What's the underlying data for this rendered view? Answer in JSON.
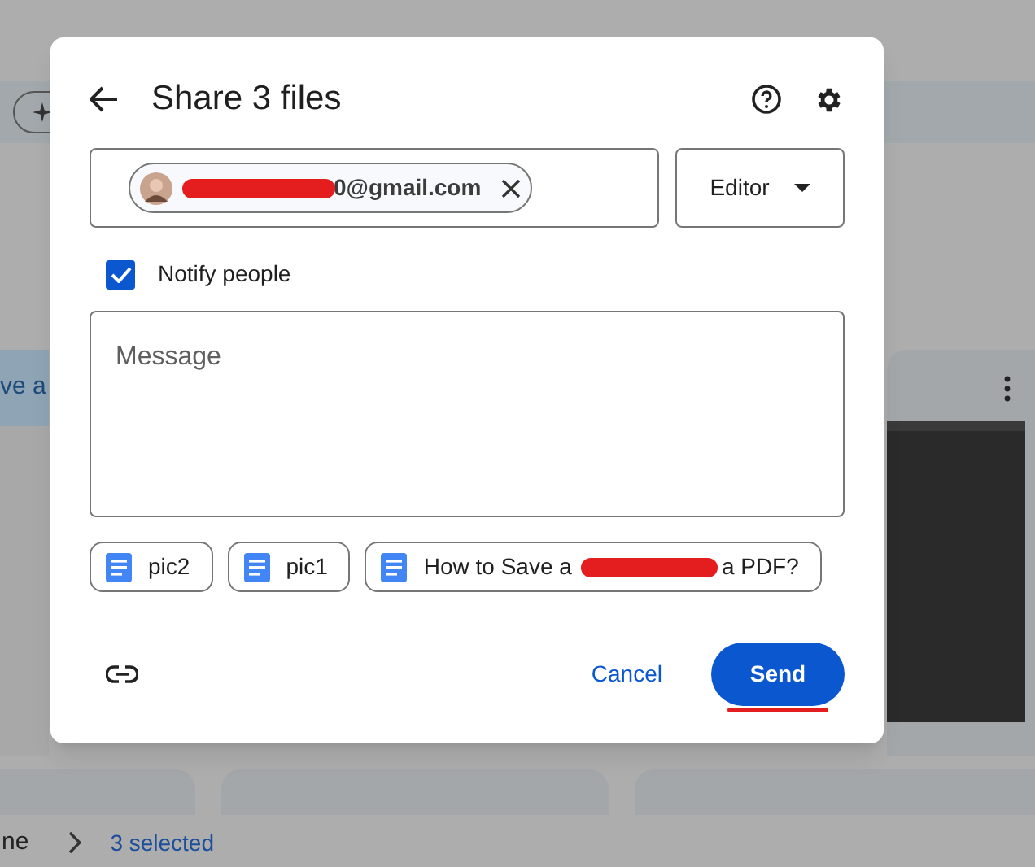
{
  "background": {
    "card_title": "ve a",
    "breadcrumb": {
      "parent": "ne",
      "current": "3 selected"
    }
  },
  "dialog": {
    "title": "Share 3 files",
    "recipient": {
      "email_visible": "0@gmail.com"
    },
    "role": "Editor",
    "notify": {
      "label": "Notify people",
      "checked": true
    },
    "message": {
      "placeholder": "Message"
    },
    "files": [
      {
        "name": "pic2"
      },
      {
        "name": "pic1"
      },
      {
        "name": "How to Save a",
        "name_end": "a PDF?"
      }
    ],
    "cancel": "Cancel",
    "send": "Send"
  }
}
